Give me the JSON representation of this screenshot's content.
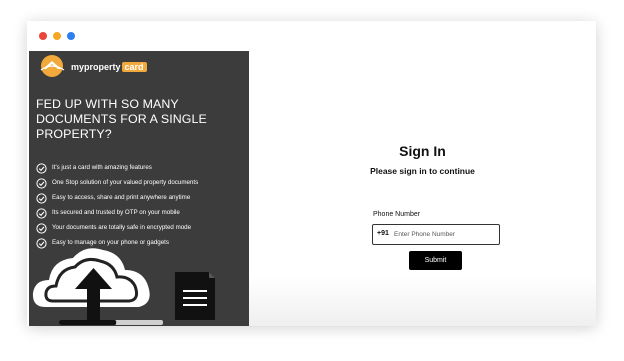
{
  "window": {
    "controls": [
      "close",
      "minimize",
      "maximize"
    ]
  },
  "brand": {
    "name_part1": "myproperty",
    "name_part2": "card",
    "accent_color": "#f2a93b"
  },
  "promo": {
    "headline": "FED UP WITH SO MANY DOCUMENTS FOR A SINGLE PROPERTY?",
    "features": [
      "It's just a card with amazing features",
      "One Stop solution of your valued property documents",
      "Easy to access, share and print anywhere anytime",
      "Its secured and trusted by OTP on your mobile",
      "Your documents are totally safe in encrypted mode",
      "Easy to manage on your phone or gadgets"
    ],
    "check_icon": "check-circle-icon",
    "illustration_icons": [
      "cloud-upload-icon",
      "document-icon"
    ],
    "upload_progress": 0.55
  },
  "signin": {
    "title": "Sign In",
    "subtitle": "Please sign in to continue",
    "phone_label": "Phone Number",
    "country_code": "+91",
    "phone_placeholder": "Enter Phone Number",
    "phone_value": "",
    "submit_label": "Submit"
  }
}
